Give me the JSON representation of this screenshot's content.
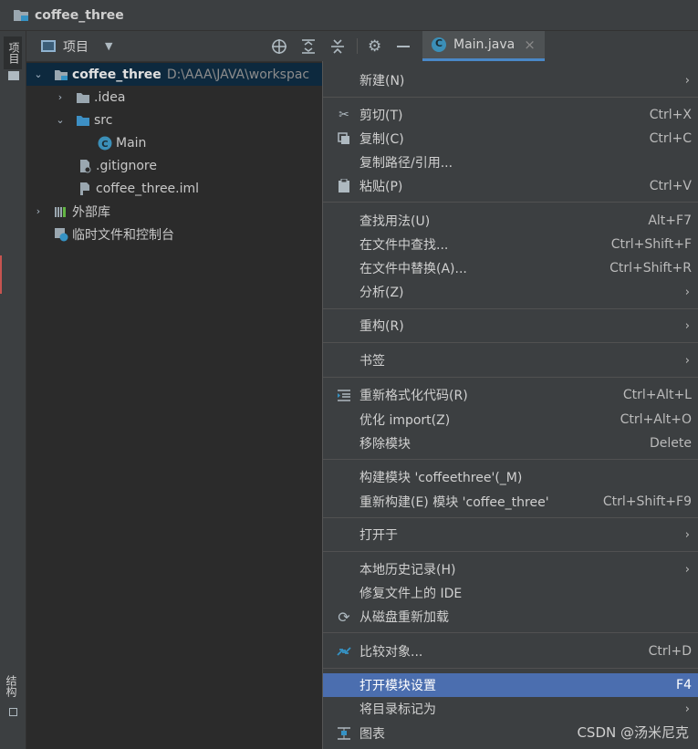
{
  "window": {
    "title": "coffee_three"
  },
  "side_tabs": {
    "project": "项目",
    "structure": "结构"
  },
  "toolbar": {
    "view_label": "项目"
  },
  "editor_tab": {
    "label": "Main.java",
    "close": "×"
  },
  "tree": [
    {
      "label": "coffee_three",
      "path": "D:\\AAA\\JAVA\\workspac",
      "expanded": true,
      "icon": "module-folder-icon"
    },
    {
      "label": ".idea",
      "icon": "folder-icon"
    },
    {
      "label": "src",
      "icon": "source-folder-icon"
    },
    {
      "label": "Main",
      "icon": "java-class-icon"
    },
    {
      "label": ".gitignore",
      "icon": "gitignore-file-icon"
    },
    {
      "label": "coffee_three.iml",
      "icon": "iml-file-icon"
    },
    {
      "label": "外部库",
      "icon": "library-icon"
    },
    {
      "label": "临时文件和控制台",
      "icon": "scratch-icon"
    }
  ],
  "menu": {
    "new": {
      "label": "新建(N)"
    },
    "cut": {
      "label": "剪切(T)",
      "shortcut": "Ctrl+X"
    },
    "copy": {
      "label": "复制(C)",
      "shortcut": "Ctrl+C"
    },
    "copy_path": {
      "label": "复制路径/引用..."
    },
    "paste": {
      "label": "粘贴(P)",
      "shortcut": "Ctrl+V"
    },
    "find_usages": {
      "label": "查找用法(U)",
      "shortcut": "Alt+F7"
    },
    "find_in_files": {
      "label": "在文件中查找...",
      "shortcut": "Ctrl+Shift+F"
    },
    "replace_in_files": {
      "label": "在文件中替换(A)...",
      "shortcut": "Ctrl+Shift+R"
    },
    "analyze": {
      "label": "分析(Z)"
    },
    "refactor": {
      "label": "重构(R)"
    },
    "bookmarks": {
      "label": "书签"
    },
    "reformat": {
      "label": "重新格式化代码(R)",
      "shortcut": "Ctrl+Alt+L"
    },
    "optimize_imports": {
      "label": "优化 import(Z)",
      "shortcut": "Ctrl+Alt+O"
    },
    "remove_module": {
      "label": "移除模块",
      "shortcut": "Delete"
    },
    "build_module": {
      "label": "构建模块 'coffeethree'(_M)"
    },
    "rebuild_module": {
      "label": "重新构建(E) 模块 'coffee_three'",
      "shortcut": "Ctrl+Shift+F9"
    },
    "open_in": {
      "label": "打开于"
    },
    "local_history": {
      "label": "本地历史记录(H)"
    },
    "repair_ide": {
      "label": "修复文件上的 IDE"
    },
    "reload_from_disk": {
      "label": "从磁盘重新加载"
    },
    "compare_with": {
      "label": "比较对象...",
      "shortcut": "Ctrl+D"
    },
    "module_settings": {
      "label": "打开模块设置",
      "shortcut": "F4"
    },
    "mark_directory": {
      "label": "将目录标记为"
    },
    "diagrams": {
      "label": "图表"
    }
  },
  "watermark": "CSDN @汤米尼克"
}
